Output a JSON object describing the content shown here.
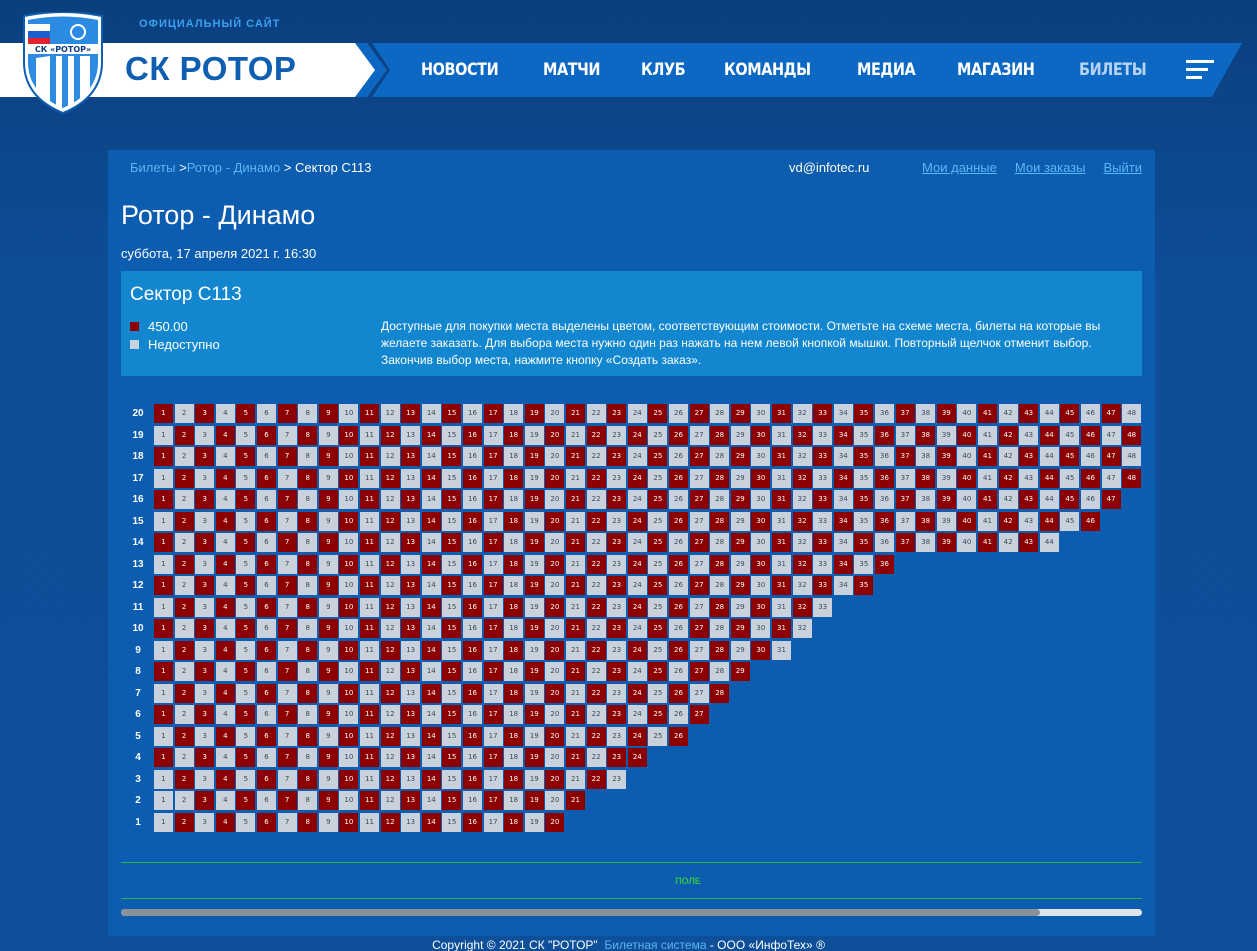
{
  "header": {
    "official_label": "ОФИЦИАЛЬНЫЙ САЙТ",
    "brand": "СК РОТОР",
    "logo_text": "СК «РОТОР»",
    "nav": [
      "НОВОСТИ",
      "МАТЧИ",
      "КЛУБ",
      "КОМАНДЫ",
      "МЕДИА",
      "МАГАЗИН",
      "БИЛЕТЫ"
    ],
    "active_nav": "БИЛЕТЫ"
  },
  "breadcrumb": {
    "item1": "Билеты",
    "sep1": " >",
    "item2": "Ротор - Динамо",
    "current": " > Сектор С113"
  },
  "user": {
    "email": "vd@infotec.ru",
    "my_data": "Мои данные",
    "my_orders": "Мои заказы",
    "logout": "Выйти"
  },
  "match": {
    "title": "Ротор - Динамо",
    "date": "суббота, 17 апреля 2021 г. 16:30"
  },
  "sector": {
    "title": "Сектор С113",
    "legend": [
      {
        "label": "450.00",
        "color": "#8d0000"
      },
      {
        "label": "Недоступно",
        "color": "#c9d2dc"
      }
    ],
    "instructions": "Доступные для покупки места выделены цветом, соответствующим стоимости. Отметьте на схеме места, билеты на которые вы желаете заказать. Для выбора места нужно один раз нажать на нем левой кнопкой мышки. Повторный щелчок отменит выбор. Закончив выбор места, нажмите кнопку «Создать заказ»."
  },
  "seat_map": {
    "rows": [
      {
        "row": 20,
        "seats": 48,
        "available": [
          1,
          3,
          5,
          7,
          9,
          11,
          13,
          15,
          17,
          19,
          21,
          23,
          25,
          27,
          29,
          31,
          33,
          35,
          37,
          39,
          41,
          43,
          45,
          47
        ]
      },
      {
        "row": 19,
        "seats": 48,
        "available": [
          2,
          4,
          6,
          8,
          10,
          12,
          14,
          16,
          18,
          20,
          22,
          24,
          26,
          28,
          30,
          32,
          34,
          36,
          38,
          40,
          42,
          44,
          46,
          48
        ]
      },
      {
        "row": 18,
        "seats": 48,
        "available": [
          1,
          3,
          5,
          7,
          9,
          11,
          13,
          15,
          17,
          19,
          21,
          23,
          25,
          27,
          29,
          31,
          33,
          35,
          37,
          39,
          41,
          43,
          45,
          47
        ]
      },
      {
        "row": 17,
        "seats": 48,
        "available": [
          2,
          4,
          6,
          8,
          10,
          12,
          14,
          16,
          18,
          20,
          22,
          24,
          26,
          28,
          30,
          32,
          34,
          36,
          38,
          40,
          42,
          44,
          46,
          48
        ]
      },
      {
        "row": 16,
        "seats": 47,
        "available": [
          1,
          3,
          5,
          7,
          9,
          11,
          13,
          15,
          17,
          19,
          21,
          23,
          25,
          27,
          29,
          31,
          33,
          35,
          37,
          39,
          41,
          43,
          45,
          47
        ]
      },
      {
        "row": 15,
        "seats": 46,
        "available": [
          2,
          4,
          6,
          8,
          10,
          12,
          14,
          16,
          18,
          20,
          22,
          24,
          26,
          28,
          30,
          32,
          34,
          36,
          38,
          40,
          42,
          44,
          46
        ]
      },
      {
        "row": 14,
        "seats": 44,
        "available": [
          1,
          3,
          5,
          7,
          9,
          11,
          13,
          15,
          17,
          19,
          21,
          23,
          25,
          27,
          29,
          31,
          33,
          35,
          37,
          39,
          41,
          43
        ]
      },
      {
        "row": 13,
        "seats": 36,
        "available": [
          2,
          4,
          6,
          8,
          10,
          12,
          14,
          16,
          18,
          20,
          22,
          24,
          26,
          28,
          30,
          32,
          34,
          36
        ]
      },
      {
        "row": 12,
        "seats": 35,
        "available": [
          1,
          3,
          5,
          7,
          9,
          11,
          13,
          15,
          17,
          19,
          21,
          23,
          25,
          27,
          29,
          31,
          33,
          35
        ]
      },
      {
        "row": 11,
        "seats": 33,
        "available": [
          2,
          4,
          6,
          8,
          10,
          12,
          14,
          16,
          18,
          20,
          22,
          24,
          26,
          28,
          30,
          32
        ]
      },
      {
        "row": 10,
        "seats": 32,
        "available": [
          1,
          3,
          5,
          7,
          9,
          11,
          13,
          15,
          17,
          19,
          21,
          23,
          25,
          27,
          29,
          31
        ]
      },
      {
        "row": 9,
        "seats": 31,
        "available": [
          2,
          4,
          6,
          8,
          10,
          12,
          14,
          16,
          18,
          20,
          22,
          24,
          26,
          28,
          30
        ]
      },
      {
        "row": 8,
        "seats": 29,
        "available": [
          1,
          3,
          5,
          7,
          9,
          11,
          13,
          15,
          17,
          19,
          21,
          23,
          25,
          27,
          29
        ]
      },
      {
        "row": 7,
        "seats": 28,
        "available": [
          2,
          4,
          6,
          8,
          10,
          12,
          14,
          16,
          18,
          20,
          22,
          24,
          26,
          28
        ]
      },
      {
        "row": 6,
        "seats": 27,
        "available": [
          1,
          3,
          5,
          7,
          9,
          11,
          13,
          15,
          17,
          19,
          21,
          23,
          25,
          27
        ]
      },
      {
        "row": 5,
        "seats": 26,
        "available": [
          2,
          4,
          6,
          8,
          10,
          12,
          14,
          16,
          18,
          20,
          22,
          24,
          26
        ]
      },
      {
        "row": 4,
        "seats": 24,
        "available": [
          1,
          3,
          5,
          7,
          9,
          11,
          13,
          15,
          17,
          19,
          21,
          23,
          24
        ]
      },
      {
        "row": 3,
        "seats": 23,
        "available": [
          2,
          4,
          6,
          8,
          10,
          12,
          14,
          16,
          18,
          20,
          22
        ]
      },
      {
        "row": 2,
        "seats": 21,
        "available": [
          3,
          5,
          7,
          9,
          11,
          13,
          15,
          17,
          19,
          21
        ]
      },
      {
        "row": 1,
        "seats": 20,
        "available": [
          2,
          4,
          6,
          8,
          10,
          12,
          14,
          16,
          18,
          20
        ]
      }
    ],
    "field_label": "ПОЛЕ",
    "scroll_position": 0.9
  },
  "footer": {
    "copyright": "Copyright © 2021 СК \"РОТОР\"",
    "link": "Билетная система",
    "company": " - ООО «ИнфоТех» ®"
  }
}
